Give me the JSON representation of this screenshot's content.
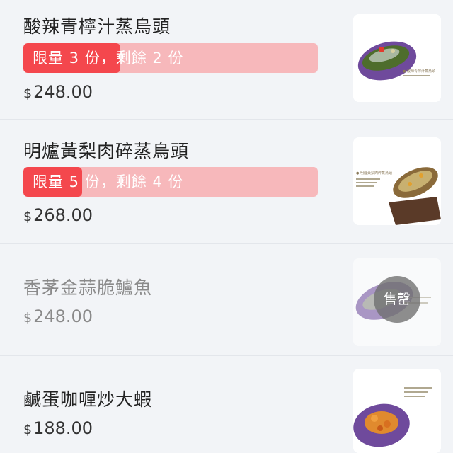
{
  "items": [
    {
      "name": "酸辣青檸汁蒸烏頭",
      "limit_text": "限量 3 份，剩餘 2 份",
      "limit_remaining_fraction": 0.33,
      "currency": "$",
      "price": "248.00",
      "image_icon": "fish-dish-image"
    },
    {
      "name": "明爐黃梨肉碎蒸烏頭",
      "limit_text": "限量 5 份，剩餘 4 份",
      "limit_remaining_fraction": 0.2,
      "currency": "$",
      "price": "268.00",
      "image_icon": "fish-dish-image"
    },
    {
      "name": "香茅金蒜脆鱸魚",
      "currency": "$",
      "price": "248.00",
      "soldout_label": "售罄",
      "image_icon": "fish-dish-image"
    },
    {
      "name": "鹹蛋咖喱炒大蝦",
      "currency": "$",
      "price": "188.00",
      "image_icon": "prawn-dish-image"
    }
  ],
  "colors": {
    "limit_fill": "#f4474d",
    "limit_track": "#f7b8bb",
    "background": "#f2f4f7"
  }
}
